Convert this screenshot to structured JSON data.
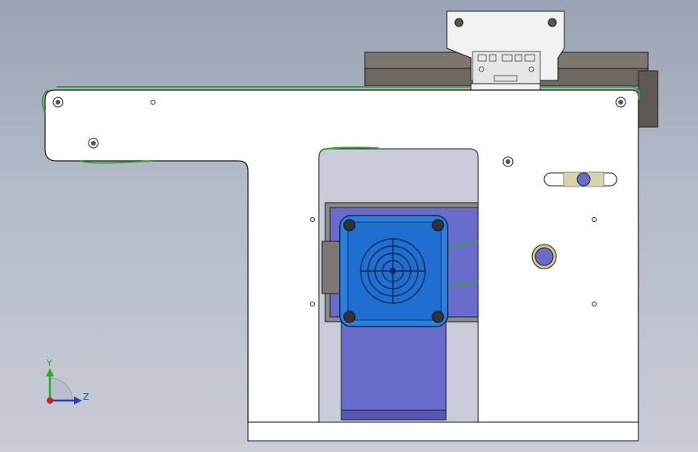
{
  "viewport": {
    "background_top": "#9aa3b4",
    "background_bottom": "#c8ccd6"
  },
  "model": {
    "frame_color": "#ffffff",
    "edge_color": "#1a1a1a",
    "belt_color": "#3aa33a",
    "motor_color": "#2a7fe0",
    "motor_bracket_color": "#6a6ccc",
    "rail_color": "#7d756f"
  },
  "triad": {
    "x_label": "",
    "y_label": "Y",
    "z_label": "Z",
    "y_color": "#20b020",
    "z_color": "#2040d0",
    "x_color": "#d02020",
    "icon": "coordinate-triad-icon"
  }
}
